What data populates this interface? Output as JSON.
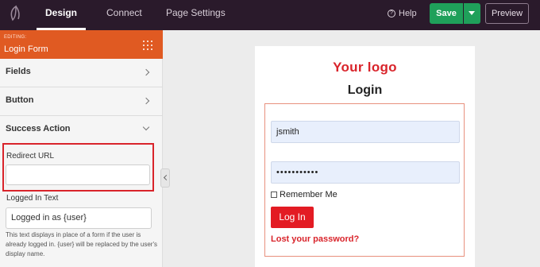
{
  "topbar": {
    "tabs": [
      {
        "label": "Design",
        "active": true
      },
      {
        "label": "Connect",
        "active": false
      },
      {
        "label": "Page Settings",
        "active": false
      }
    ],
    "help_label": "Help",
    "save_label": "Save",
    "preview_label": "Preview"
  },
  "sidebar": {
    "editing_label": "EDITING:",
    "title": "Login Form",
    "sections": [
      {
        "label": "Fields",
        "expanded": false
      },
      {
        "label": "Button",
        "expanded": false
      },
      {
        "label": "Success Action",
        "expanded": true
      }
    ],
    "redirect_url": {
      "label": "Redirect URL",
      "value": ""
    },
    "logged_in_text": {
      "label": "Logged In Text",
      "value": "Logged in as {user}"
    },
    "help_text": "This text displays in place of a form if the user is already logged in. {user} will be replaced by the user's display name."
  },
  "preview": {
    "logo_text": "Your logo",
    "heading": "Login",
    "username_value": "jsmith",
    "password_value": "•••••••••••",
    "remember_label": "Remember Me",
    "login_button": "Log In",
    "lost_password_link": "Lost your password?"
  },
  "colors": {
    "topbar_bg": "#2a1a2b",
    "editing_header": "#e05a22",
    "save_green": "#1fa05a",
    "accent_red": "#d9242b"
  },
  "icons": {
    "app_logo": "leaf-logo-icon",
    "help": "help-circle-icon",
    "save_dropdown": "chevron-down-icon",
    "drag": "drag-handle-icon",
    "collapse": "chevron-left-icon"
  }
}
